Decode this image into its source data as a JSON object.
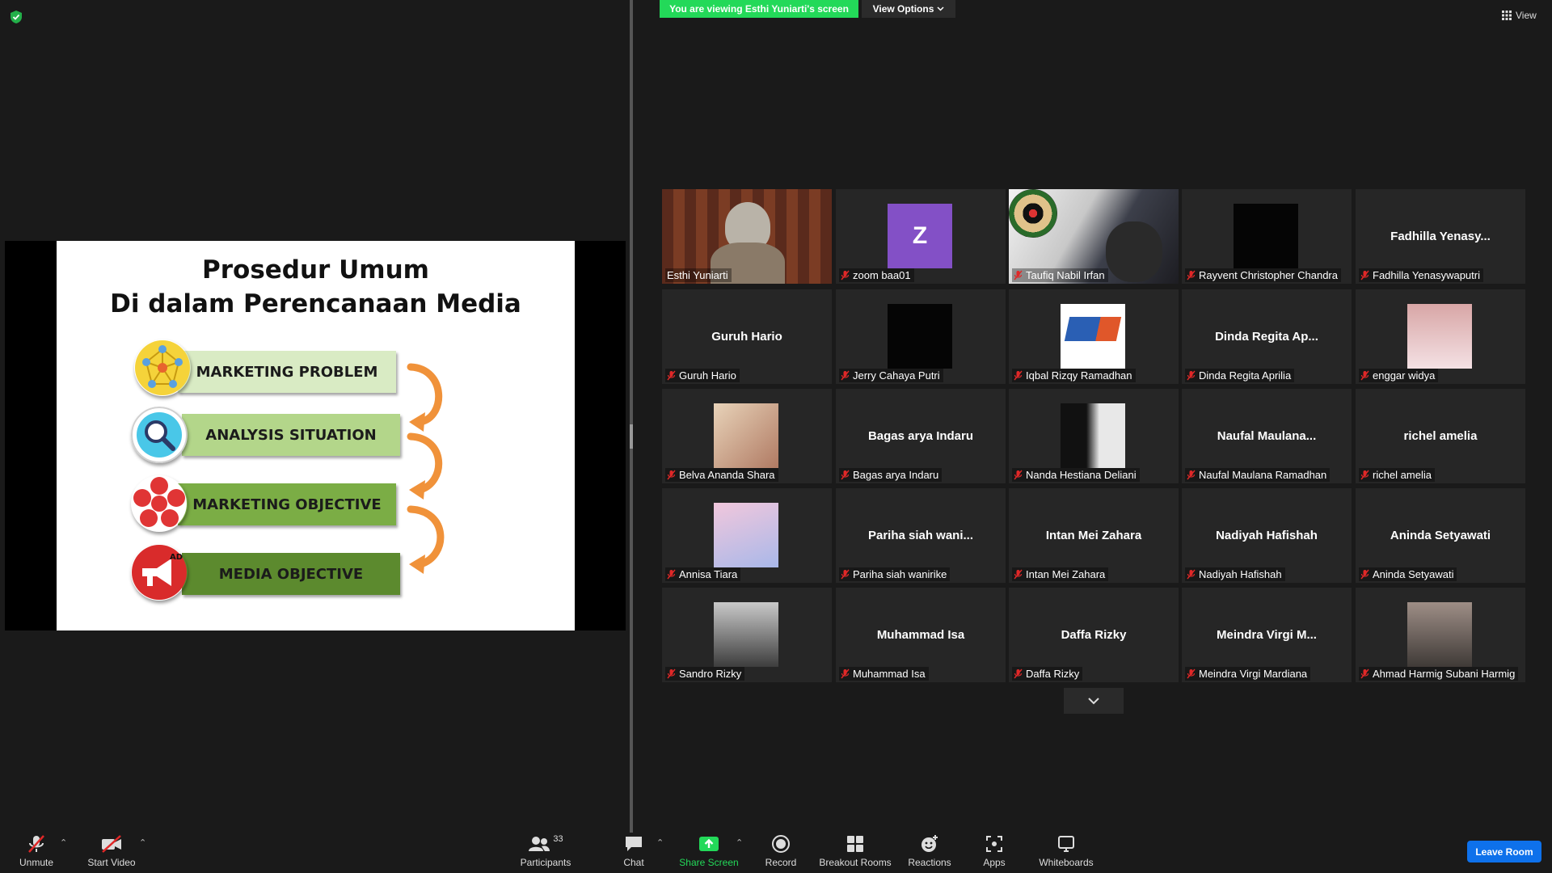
{
  "banner": {
    "viewing_text": "You are viewing Esthi Yuniarti's screen",
    "view_options_label": "View Options",
    "view_label": "View"
  },
  "slide": {
    "title_line1": "Prosedur Umum",
    "title_line2": "Di dalam Perencanaan Media",
    "steps": [
      "MARKETING PROBLEM",
      "ANALYSIS SITUATION",
      "MARKETING OBJECTIVE",
      "MEDIA OBJECTIVE"
    ],
    "ad_label": "AD"
  },
  "participants": [
    {
      "display": "",
      "label": "Esthi Yuniarti",
      "kind": "video"
    },
    {
      "display": "Z",
      "label": "zoom baa01",
      "kind": "avatar"
    },
    {
      "display": "",
      "label": "Taufiq Nabil Irfan",
      "kind": "video"
    },
    {
      "display": "",
      "label": "Rayvent Christopher Chandra",
      "kind": "blackthumb"
    },
    {
      "display": "Fadhilla  Yenasy...",
      "label": "Fadhilla Yenasywaputri",
      "kind": "name"
    },
    {
      "display": "Guruh Hario",
      "label": "Guruh Hario",
      "kind": "name"
    },
    {
      "display": "",
      "label": "Jerry Cahaya Putri",
      "kind": "blackthumb"
    },
    {
      "display": "",
      "label": "Iqbal Rizqy Ramadhan",
      "kind": "logo"
    },
    {
      "display": "Dinda  Regita  Ap...",
      "label": "Dinda Regita Aprilia",
      "kind": "name"
    },
    {
      "display": "",
      "label": "enggar widya",
      "kind": "photo"
    },
    {
      "display": "",
      "label": "Belva Ananda Shara",
      "kind": "photo"
    },
    {
      "display": "Bagas arya Indaru",
      "label": "Bagas arya Indaru",
      "kind": "name"
    },
    {
      "display": "",
      "label": "Nanda Hestiana Deliani",
      "kind": "photo"
    },
    {
      "display": "Naufal  Maulana...",
      "label": "Naufal Maulana Ramadhan",
      "kind": "name"
    },
    {
      "display": "richel amelia",
      "label": "richel amelia",
      "kind": "name"
    },
    {
      "display": "",
      "label": "Annisa Tiara",
      "kind": "photo"
    },
    {
      "display": "Pariha  siah  wani...",
      "label": "Pariha siah wanirike",
      "kind": "name"
    },
    {
      "display": "Intan Mei Zahara",
      "label": "Intan Mei Zahara",
      "kind": "name"
    },
    {
      "display": "Nadiyah Hafishah",
      "label": "Nadiyah Hafishah",
      "kind": "name"
    },
    {
      "display": "Aninda Setyawati",
      "label": "Aninda Setyawati",
      "kind": "name"
    },
    {
      "display": "",
      "label": "Sandro Rizky",
      "kind": "photo"
    },
    {
      "display": "Muhammad Isa",
      "label": "Muhammad Isa",
      "kind": "name"
    },
    {
      "display": "Daffa Rizky",
      "label": "Daffa Rizky",
      "kind": "name"
    },
    {
      "display": "Meindra  Virgi  M...",
      "label": "Meindra Virgi Mardiana",
      "kind": "name"
    },
    {
      "display": "",
      "label": "Ahmad Harmig Subani Harmig",
      "kind": "photo"
    }
  ],
  "toolbar": {
    "unmute": "Unmute",
    "start_video": "Start Video",
    "participants": "Participants",
    "participants_count": "33",
    "chat": "Chat",
    "share_screen": "Share Screen",
    "record": "Record",
    "breakout_rooms": "Breakout Rooms",
    "reactions": "Reactions",
    "apps": "Apps",
    "whiteboards": "Whiteboards",
    "leave": "Leave Room"
  },
  "colors": {
    "share_green": "#23d959",
    "active_speaker": "#d8e84a",
    "leave_blue": "#0e71eb",
    "mute_red": "#e02828"
  }
}
